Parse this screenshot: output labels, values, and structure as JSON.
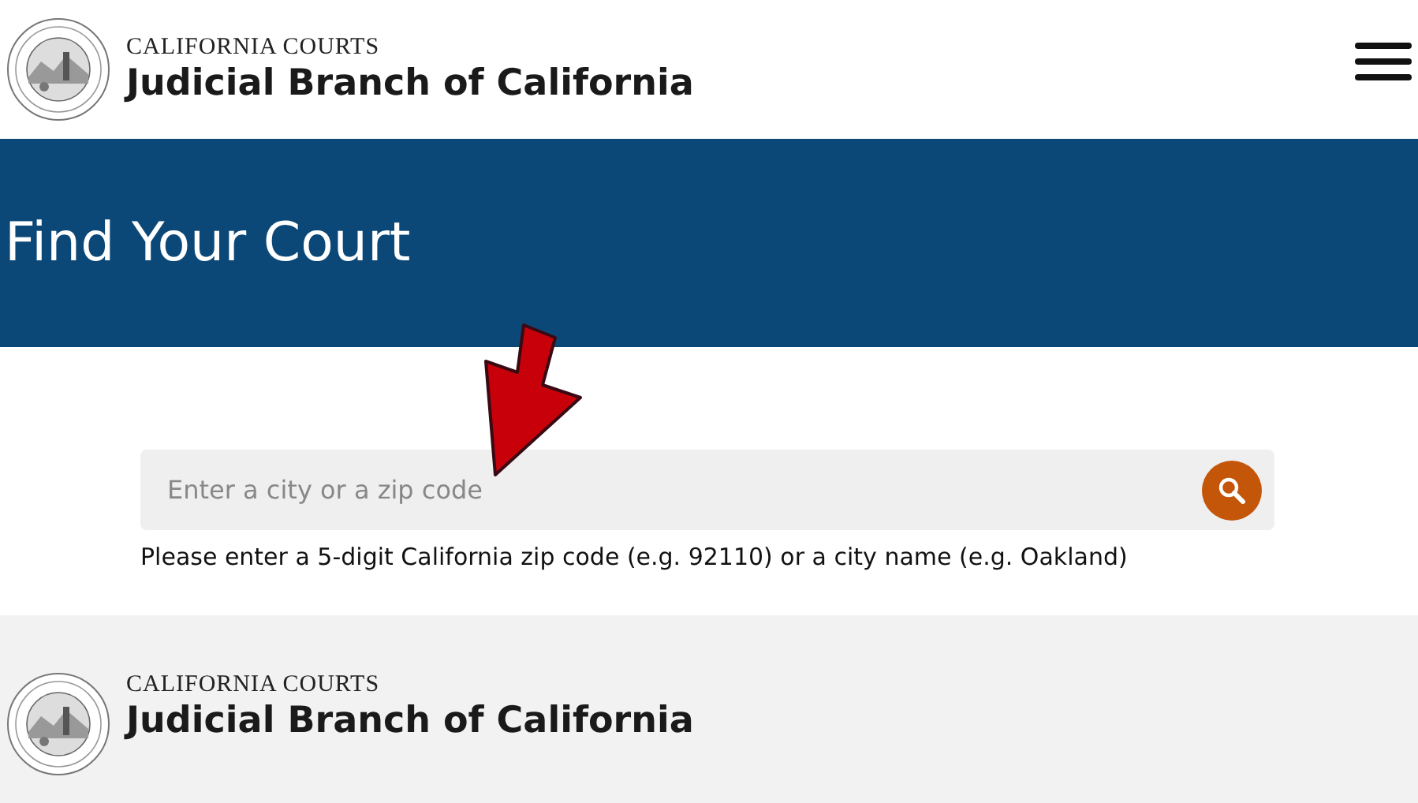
{
  "header": {
    "kicker": "CALIFORNIA COURTS",
    "title": "Judicial Branch of California"
  },
  "banner": {
    "title": "Find Your Court"
  },
  "search": {
    "placeholder": "Enter a city or a zip code",
    "hint": "Please enter a 5-digit California zip code (e.g. 92110) or a city name (e.g. Oakland)"
  },
  "footer": {
    "kicker": "CALIFORNIA COURTS",
    "title": "Judicial Branch of California"
  }
}
